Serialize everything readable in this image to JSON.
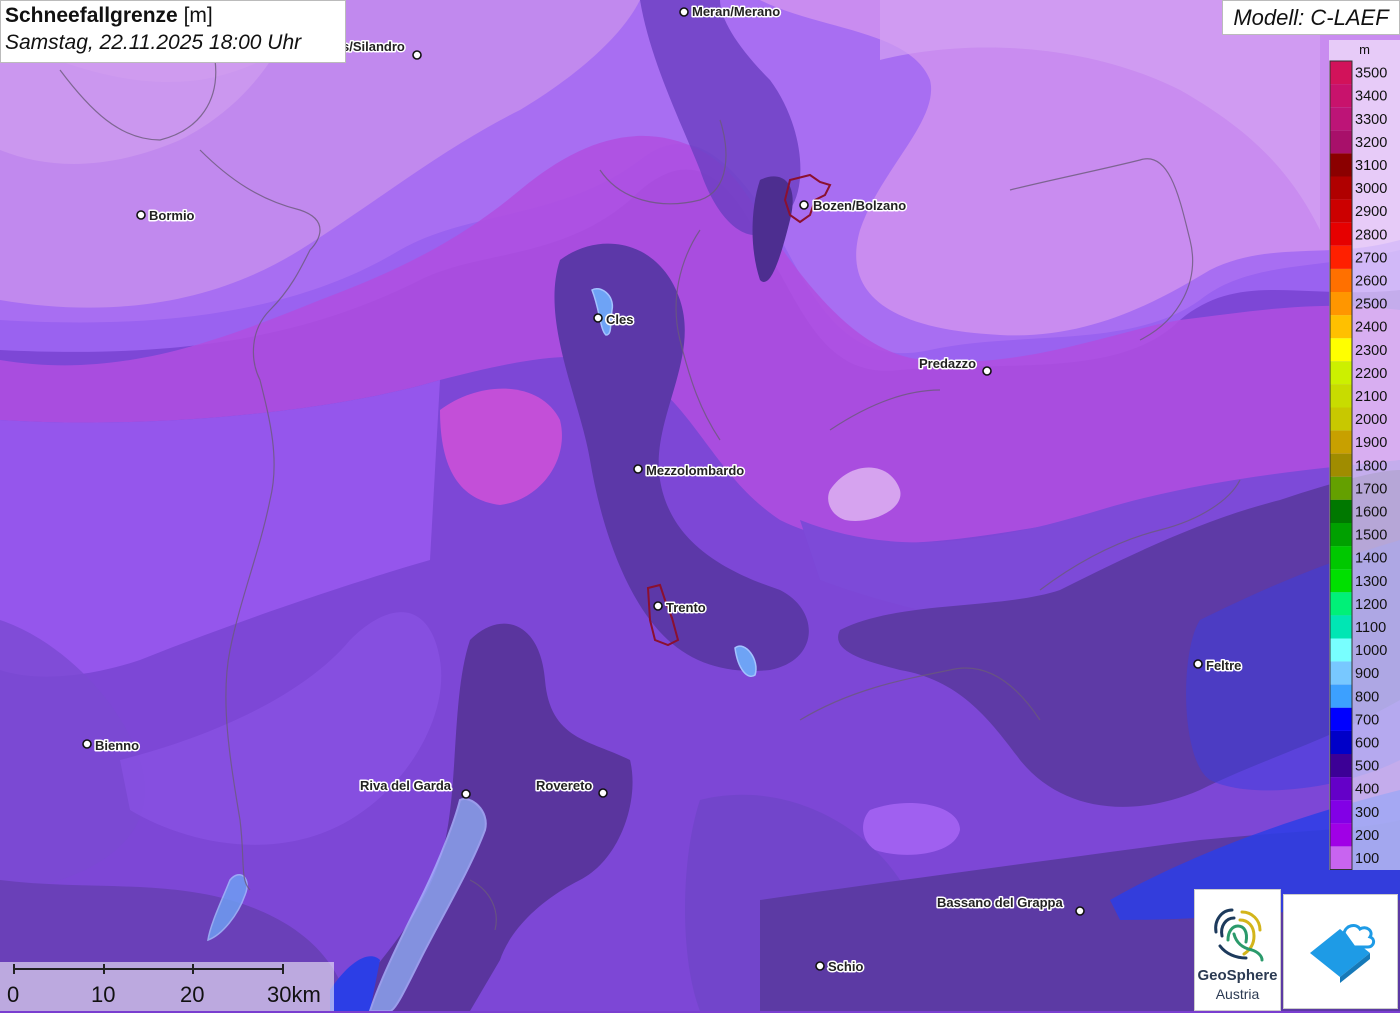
{
  "title": {
    "main_bold": "Schneefallgrenze",
    "main_unit": "[m]",
    "subtitle": "Samstag, 22.11.2025 18:00 Uhr"
  },
  "model": "Modell: C-LAEF",
  "legend": {
    "unit": "m",
    "levels": [
      {
        "value": "3500",
        "color": "#d2125a"
      },
      {
        "value": "3400",
        "color": "#c8126c"
      },
      {
        "value": "3300",
        "color": "#bd1477"
      },
      {
        "value": "3200",
        "color": "#a8106a"
      },
      {
        "value": "3100",
        "color": "#8b0000"
      },
      {
        "value": "3000",
        "color": "#b00000"
      },
      {
        "value": "2900",
        "color": "#cc0000"
      },
      {
        "value": "2800",
        "color": "#e60000"
      },
      {
        "value": "2700",
        "color": "#ff2000"
      },
      {
        "value": "2600",
        "color": "#ff7000"
      },
      {
        "value": "2500",
        "color": "#ff9600"
      },
      {
        "value": "2400",
        "color": "#ffc000"
      },
      {
        "value": "2300",
        "color": "#ffff00"
      },
      {
        "value": "2200",
        "color": "#ccf000"
      },
      {
        "value": "2100",
        "color": "#c8dc00"
      },
      {
        "value": "2000",
        "color": "#c8c800"
      },
      {
        "value": "1900",
        "color": "#c8a000"
      },
      {
        "value": "1800",
        "color": "#a08c00"
      },
      {
        "value": "1700",
        "color": "#64a000"
      },
      {
        "value": "1600",
        "color": "#007800"
      },
      {
        "value": "1500",
        "color": "#00a000"
      },
      {
        "value": "1400",
        "color": "#00c800"
      },
      {
        "value": "1300",
        "color": "#00e000"
      },
      {
        "value": "1200",
        "color": "#00f078"
      },
      {
        "value": "1100",
        "color": "#00e6b4"
      },
      {
        "value": "1000",
        "color": "#78ffff"
      },
      {
        "value": "900",
        "color": "#78c8ff"
      },
      {
        "value": "800",
        "color": "#3ca0ff"
      },
      {
        "value": "700",
        "color": "#0000ff"
      },
      {
        "value": "600",
        "color": "#0000c8"
      },
      {
        "value": "500",
        "color": "#3c0096"
      },
      {
        "value": "400",
        "color": "#6400c8"
      },
      {
        "value": "300",
        "color": "#8200e6"
      },
      {
        "value": "200",
        "color": "#a000e6"
      },
      {
        "value": "100",
        "color": "#c864f0"
      }
    ]
  },
  "cities": [
    {
      "name": "Meran/Merano"
    },
    {
      "name": "s/Silandro"
    },
    {
      "name": "Bormio"
    },
    {
      "name": "Bozen/Bolzano"
    },
    {
      "name": "Cles"
    },
    {
      "name": "Predazzo"
    },
    {
      "name": "Mezzolombardo"
    },
    {
      "name": "Trento"
    },
    {
      "name": "Feltre"
    },
    {
      "name": "Bienno"
    },
    {
      "name": "Riva del Garda"
    },
    {
      "name": "Rovereto"
    },
    {
      "name": "Bassano del Grappa"
    },
    {
      "name": "Schio"
    }
  ],
  "scale": {
    "labels": [
      "0",
      "10",
      "20",
      "30km"
    ]
  },
  "logo": {
    "name": "GeoSphere",
    "sub": "Austria"
  },
  "colors": {
    "lightest": "#c98cf0",
    "light": "#b27af0",
    "mid": "#9c62f2",
    "dark": "#7f48d8",
    "darker": "#5e36a8",
    "magenta": "#bb44e6",
    "blue": "#2c3ee6"
  }
}
